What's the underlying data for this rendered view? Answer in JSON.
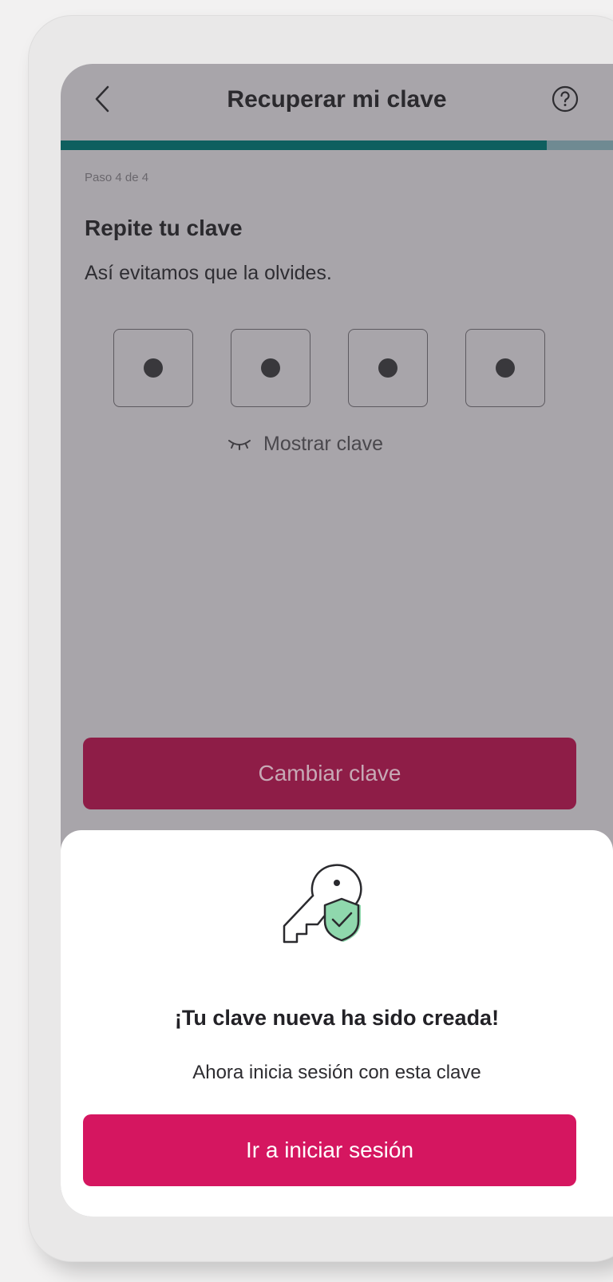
{
  "header": {
    "title": "Recuperar mi clave",
    "back_icon": "chevron-left-icon",
    "help_icon": "question-circle-icon"
  },
  "progress": {
    "current_step": 4,
    "total_steps": 4,
    "fill_fraction": 0.88,
    "fill_color": "#0e5f5f",
    "track_color": "#6f8a92"
  },
  "step_label": "Paso 4 de 4",
  "section": {
    "title": "Repite tu clave",
    "subtitle": "Así evitamos que la olvides."
  },
  "pin": {
    "length": 4,
    "filled": 4
  },
  "show_pin": {
    "icon": "eye-closed-icon",
    "label": "Mostrar clave"
  },
  "change_button": {
    "label": "Cambiar clave",
    "color": "#8e1d47"
  },
  "sheet": {
    "illustration": "key-shield-check-icon",
    "title": "¡Tu clave nueva ha sido creada!",
    "text": "Ahora inicia sesión con esta clave",
    "button_label": "Ir a iniciar sesión",
    "button_color": "#d51660",
    "accent_color": "#3cb97a"
  }
}
